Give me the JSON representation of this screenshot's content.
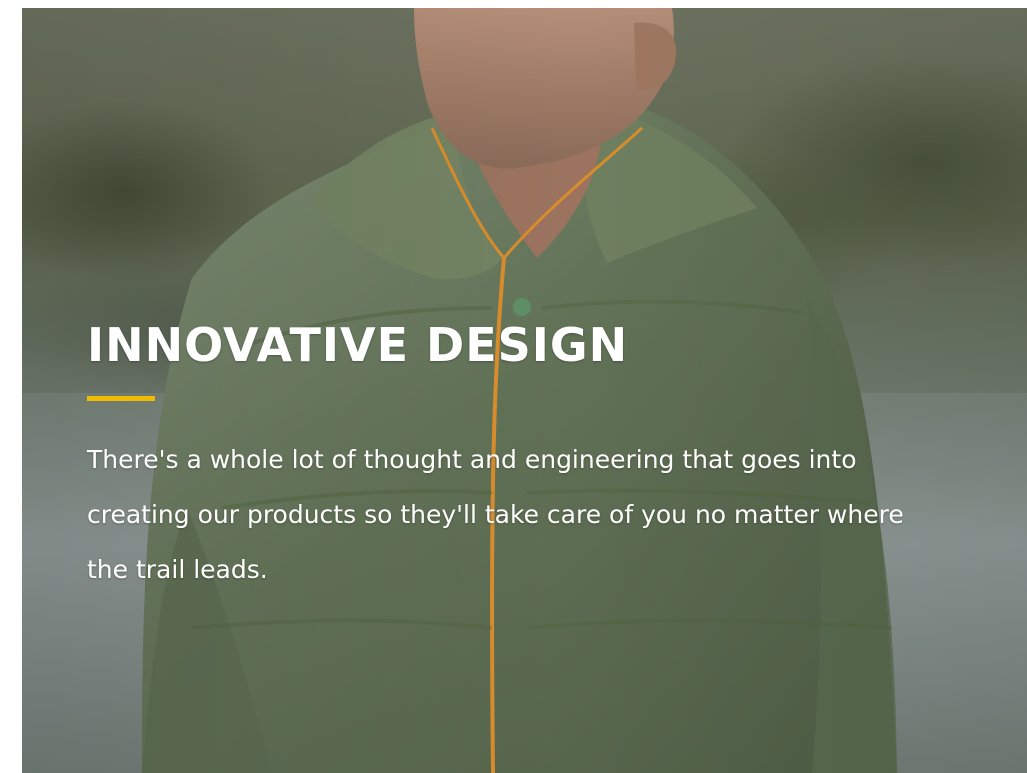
{
  "section": {
    "title": "INNOVATIVE DESIGN",
    "accent_color": "#f0bc00",
    "body": "There's a whole lot of thought and engineering that goes into creating our products so they'll take care of you no matter where the trail leads."
  },
  "hero_image": {
    "subject": "person-in-green-puffy-jacket"
  }
}
